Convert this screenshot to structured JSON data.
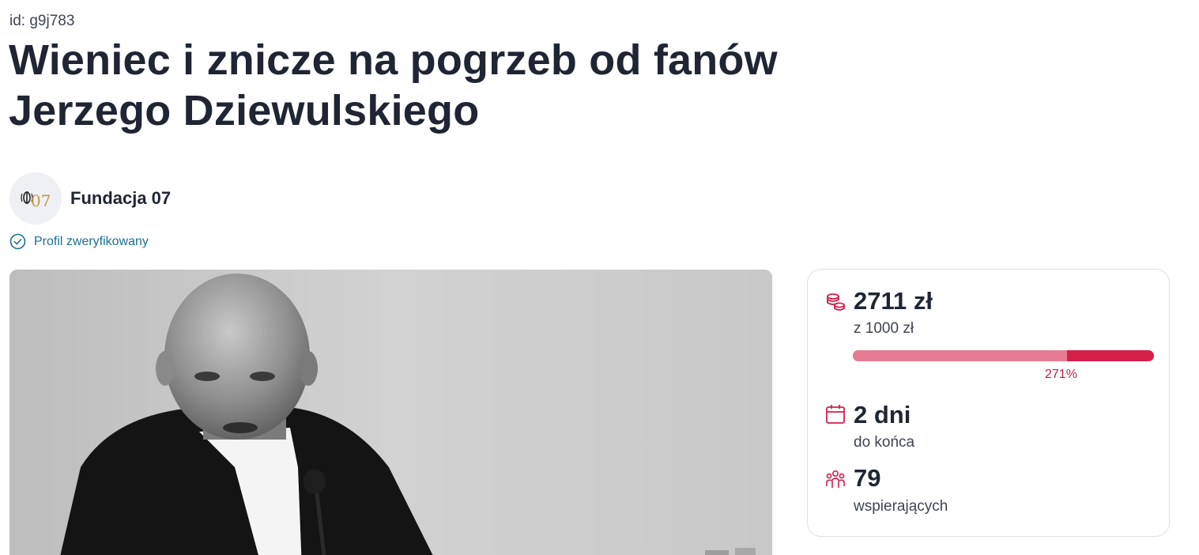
{
  "campaign": {
    "id_label": "id: g9j783",
    "title": "Wieniec i znicze na pogrzeb od fanów Jerzego Dziewulskiego"
  },
  "organizer": {
    "name": "Fundacja 07",
    "logo_text": "07",
    "verified_label": "Profil zweryfikowany"
  },
  "stats": {
    "raised": "2711 zł",
    "goal": "z 1000 zł",
    "progress_label": "271%",
    "progress_fraction": 0.71,
    "days_left": "2 dni",
    "days_left_label": "do końca",
    "supporters": "79",
    "supporters_label": "wspierających",
    "icons": {
      "raised": "coins-icon",
      "days": "calendar-icon",
      "supporters": "people-icon"
    }
  },
  "colors": {
    "accent": "#d51f4b",
    "accent_light": "#e67b93",
    "verified": "#1c6f8f",
    "text": "#1f2533"
  }
}
